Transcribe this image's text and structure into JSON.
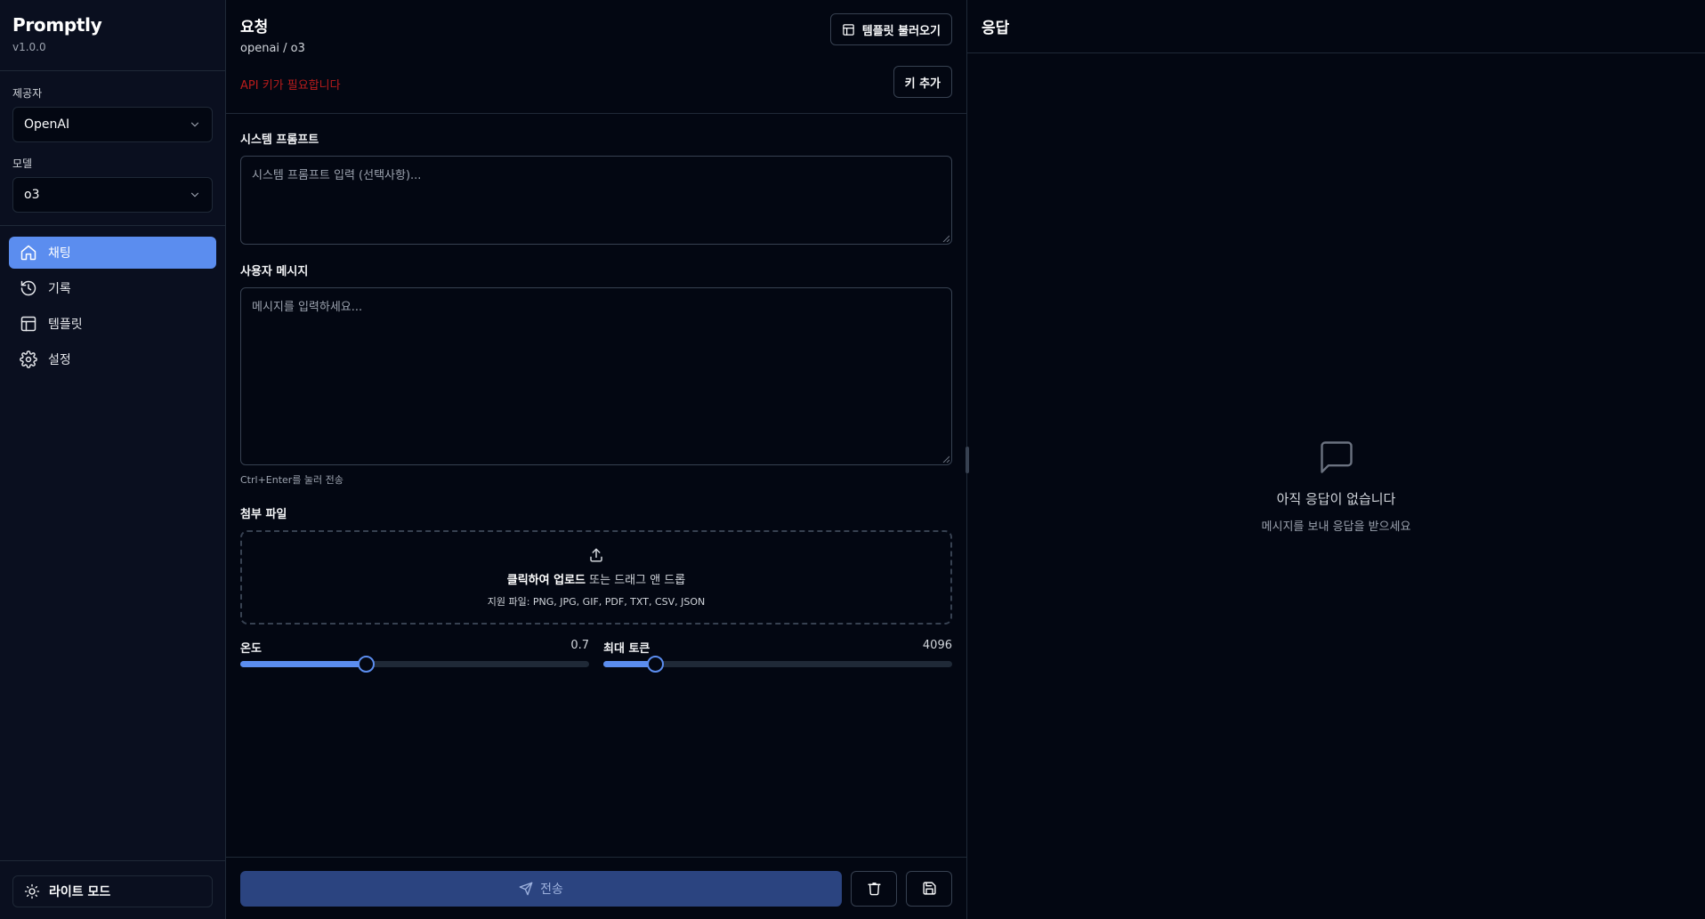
{
  "app": {
    "name": "Promptly",
    "version": "v1.0.0"
  },
  "sidebar": {
    "provider_label": "제공자",
    "provider_value": "OpenAI",
    "model_label": "모델",
    "model_value": "o3",
    "nav": [
      {
        "label": "채팅",
        "icon": "home-icon",
        "active": true
      },
      {
        "label": "기록",
        "icon": "history-icon",
        "active": false
      },
      {
        "label": "템플릿",
        "icon": "template-icon",
        "active": false
      },
      {
        "label": "설정",
        "icon": "gear-icon",
        "active": false
      }
    ],
    "theme_toggle": "라이트 모드"
  },
  "request": {
    "title": "요청",
    "subtitle": "openai / o3",
    "api_warning": "API 키가 필요합니다",
    "load_template_button": "템플릿 불러오기",
    "add_key_button": "키 추가",
    "system_prompt_label": "시스템 프롬프트",
    "system_prompt_placeholder": "시스템 프롬프트 입력 (선택사항)...",
    "user_message_label": "사용자 메시지",
    "user_message_placeholder": "메시지를 입력하세요...",
    "send_hint": "Ctrl+Enter를 눌러 전송",
    "attachments_label": "첨부 파일",
    "upload_bold": "클릭하여 업로드",
    "upload_rest": " 또는 드래그 앤 드롭",
    "upload_supported": "지원 파일: PNG, JPG, GIF, PDF, TXT, CSV, JSON",
    "temperature_label": "온도",
    "temperature_value": "0.7",
    "temperature_fraction": 0.36,
    "max_tokens_label": "최대 토큰",
    "max_tokens_value": "4096",
    "max_tokens_fraction": 0.148,
    "send_button": "전송"
  },
  "response": {
    "title": "응답",
    "empty_title": "아직 응답이 없습니다",
    "empty_subtitle": "메시지를 보내 응답을 받으세요"
  },
  "colors": {
    "accent": "#5b8def",
    "background": "#030712",
    "warning": "#b91c1c"
  }
}
